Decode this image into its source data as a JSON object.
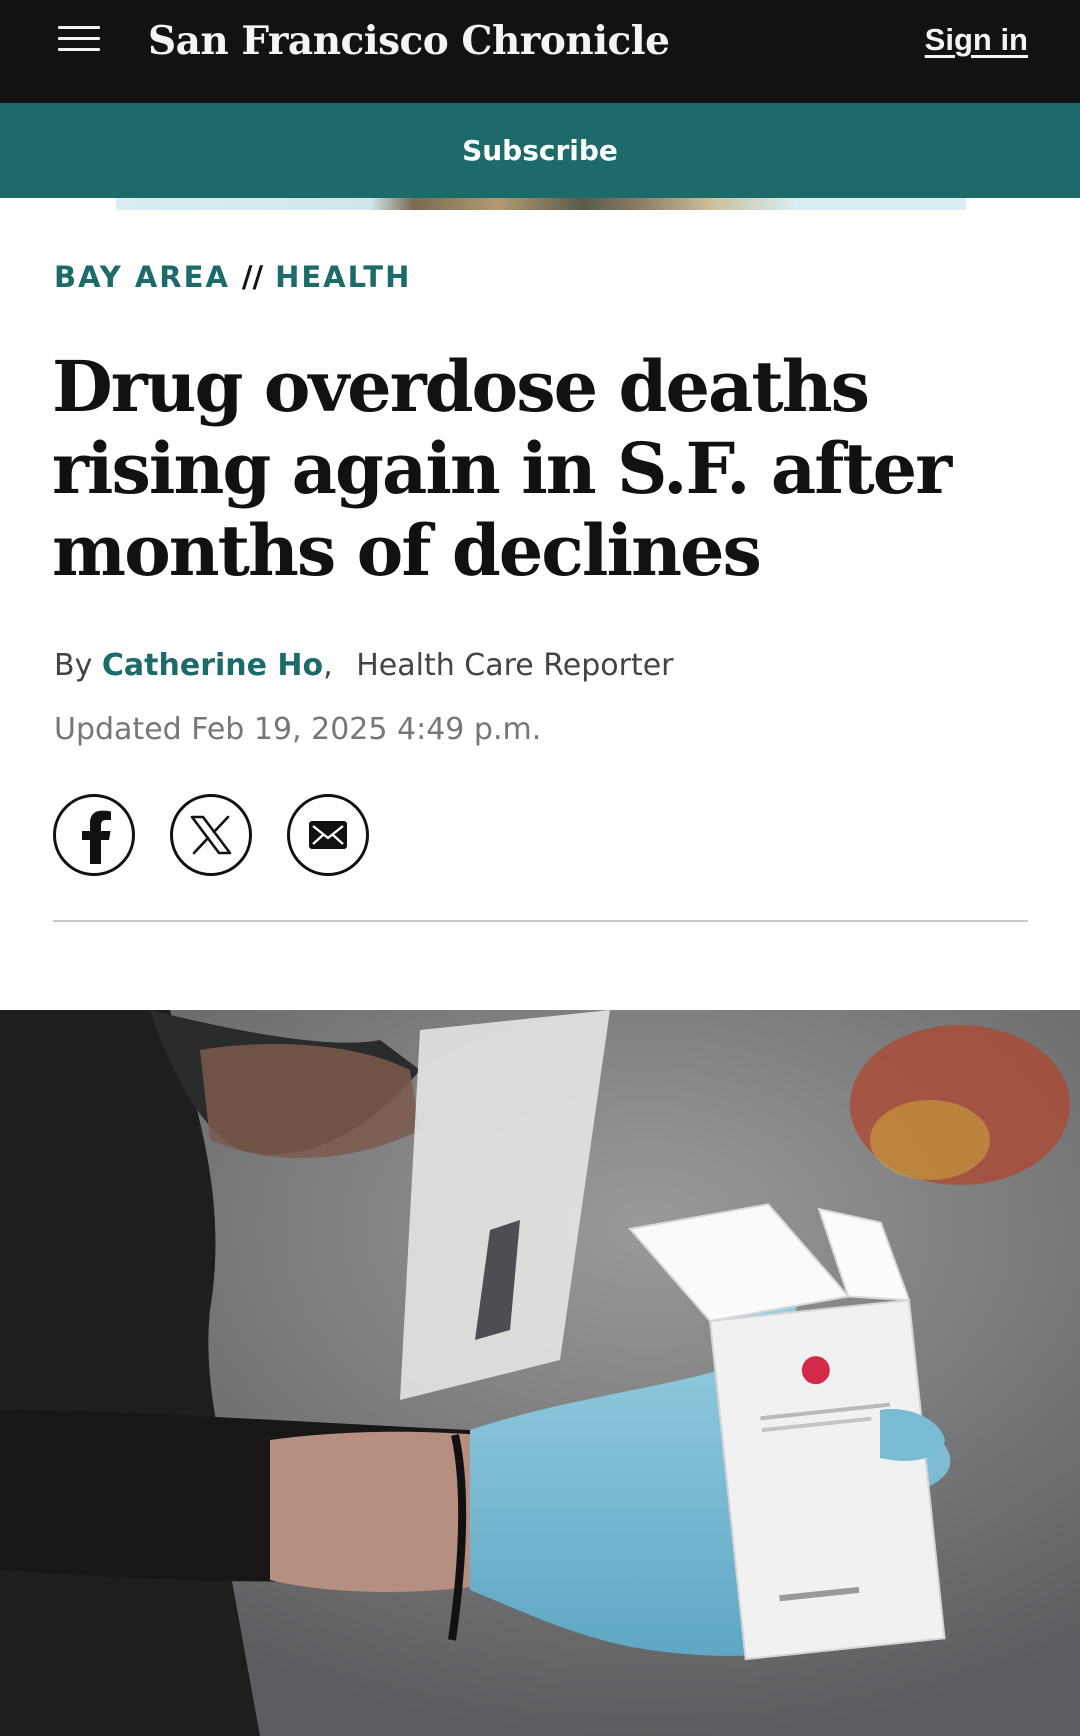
{
  "header": {
    "logo": "San Francisco Chronicle",
    "sign_in": "Sign in",
    "menu_icon": "hamburger-menu-icon"
  },
  "subscribe": {
    "label": "Subscribe",
    "color": "#1d6a6b"
  },
  "article": {
    "section": "BAY AREA",
    "separator": "//",
    "subsection": "HEALTH",
    "headline": "Drug overdose deaths rising again in S.F. after months of declines",
    "byline_prefix": "By",
    "author": "Catherine Ho",
    "byline_comma": ",",
    "author_role": "Health Care Reporter",
    "updated": "Updated Feb 19, 2025 4:49 p.m."
  },
  "share": [
    {
      "icon": "facebook-icon"
    },
    {
      "icon": "x-icon"
    },
    {
      "icon": "email-icon"
    }
  ],
  "colors": {
    "topbar": "#121212",
    "accent": "#1d6a6b",
    "headline": "#111111"
  }
}
